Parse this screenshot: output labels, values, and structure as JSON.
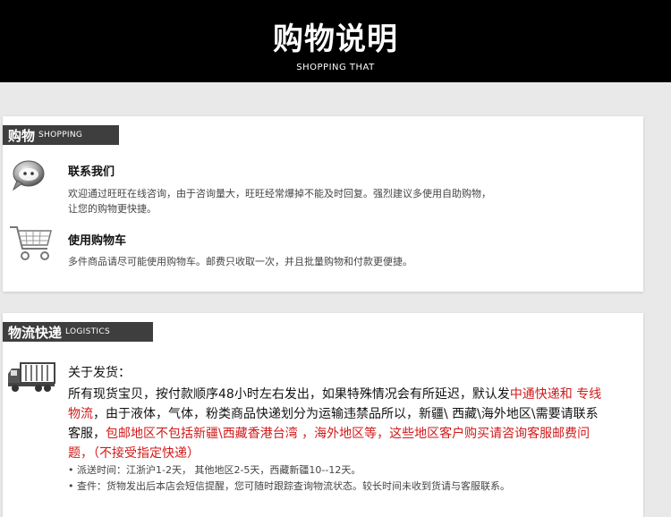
{
  "header": {
    "title": "购物说明",
    "subtitle": "SHOPPING THAT"
  },
  "shopping": {
    "tag_cn": "购物",
    "tag_en": "SHOPPING",
    "items": [
      {
        "icon": "chat-bubble-icon",
        "title": "联系我们",
        "lines": [
          "欢迎通过旺旺在线咨询，由于咨询量大，旺旺经常爆掉不能及时回复。强烈建议多使用自助购物，",
          "让您的购物更快捷。"
        ]
      },
      {
        "icon": "shopping-cart-icon",
        "title": "使用购物车",
        "lines": [
          "多件商品请尽可能使用购物车。邮费只收取一次，并且批量购物和付款更便捷。"
        ]
      }
    ]
  },
  "logistics": {
    "tag_cn": "物流快递",
    "tag_en": "LOGISTICS",
    "icon": "truck-icon",
    "heading": "关于发货：",
    "para": {
      "p1": "所有现货宝贝，按付款顺序48小时左右发出，如果特殊情况会有所延迟，默认发",
      "p2_red": "中通快递和 专线物流",
      "p3": "，由于液体，气体，粉类商品快递划分为运输违禁品所以，新疆\\ 西藏\\海外地区\\需要请联系客服，",
      "p4_red": "包邮地区不包括新疆\\西藏香港台湾 ，海外地区等，这些地区客户购买请咨询客服邮费问题，（不接受指定快递）"
    },
    "notes": [
      "• 派送时间：江浙沪1-2天，  其他地区2-5天，西藏新疆10--12天。",
      "• 查件：货物发出后本店会短信提醒，您可随时跟踪查询物流状态。较长时间未收到货请与客服联系。"
    ]
  }
}
